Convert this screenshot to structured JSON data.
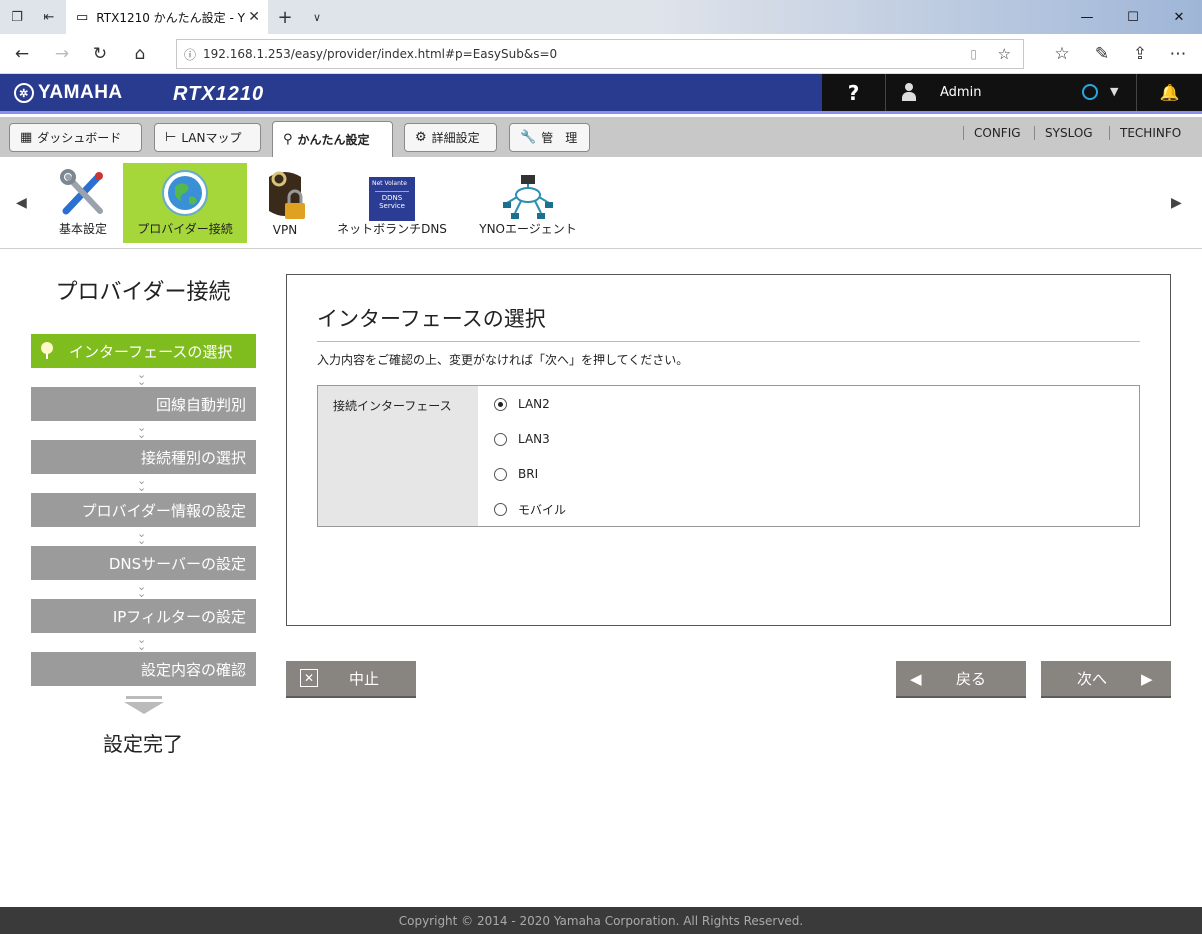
{
  "browser": {
    "tab_title": "RTX1210 かんたん設定 - Y",
    "url": "192.168.1.253/easy/provider/index.html#p=EasySub&s=0"
  },
  "header": {
    "brand": "YAMAHA",
    "model": "RTX1210",
    "help": "?",
    "user": "Admin",
    "accent_color": "#283b8f"
  },
  "menu": {
    "tabs": [
      "ダッシュボード",
      "LANマップ",
      "かんたん設定",
      "詳細設定",
      "管　理"
    ],
    "active_tab": "かんたん設定",
    "links": [
      "CONFIG",
      "SYSLOG",
      "TECHINFO"
    ]
  },
  "functions": {
    "items": [
      "基本設定",
      "プロバイダー接続",
      "VPN",
      "ネットボランチDNS",
      "YNOエージェント"
    ],
    "active": "プロバイダー接続",
    "ddns_icon_text": [
      "Net Volante",
      "DDNS",
      "Service"
    ],
    "active_color": "#a5d63a"
  },
  "steps": {
    "title": "プロバイダー接続",
    "items": [
      "インターフェースの選択",
      "回線自動判別",
      "接続種別の選択",
      "プロバイダー情報の設定",
      "DNSサーバーの設定",
      "IPフィルターの設定",
      "設定内容の確認"
    ],
    "active_index": 0,
    "done_label": "設定完了",
    "active_color": "#7fbd1e"
  },
  "main": {
    "title": "インターフェースの選択",
    "description": "入力内容をご確認の上、変更がなければ「次へ」を押してください。",
    "field_label": "接続インターフェース",
    "options": [
      "LAN2",
      "LAN3",
      "BRI",
      "モバイル"
    ],
    "selected": "LAN2"
  },
  "actions": {
    "cancel": "中止",
    "back": "戻る",
    "next": "次へ"
  },
  "footer": {
    "copyright": "Copyright © 2014 - 2020 Yamaha Corporation. All Rights Reserved."
  }
}
